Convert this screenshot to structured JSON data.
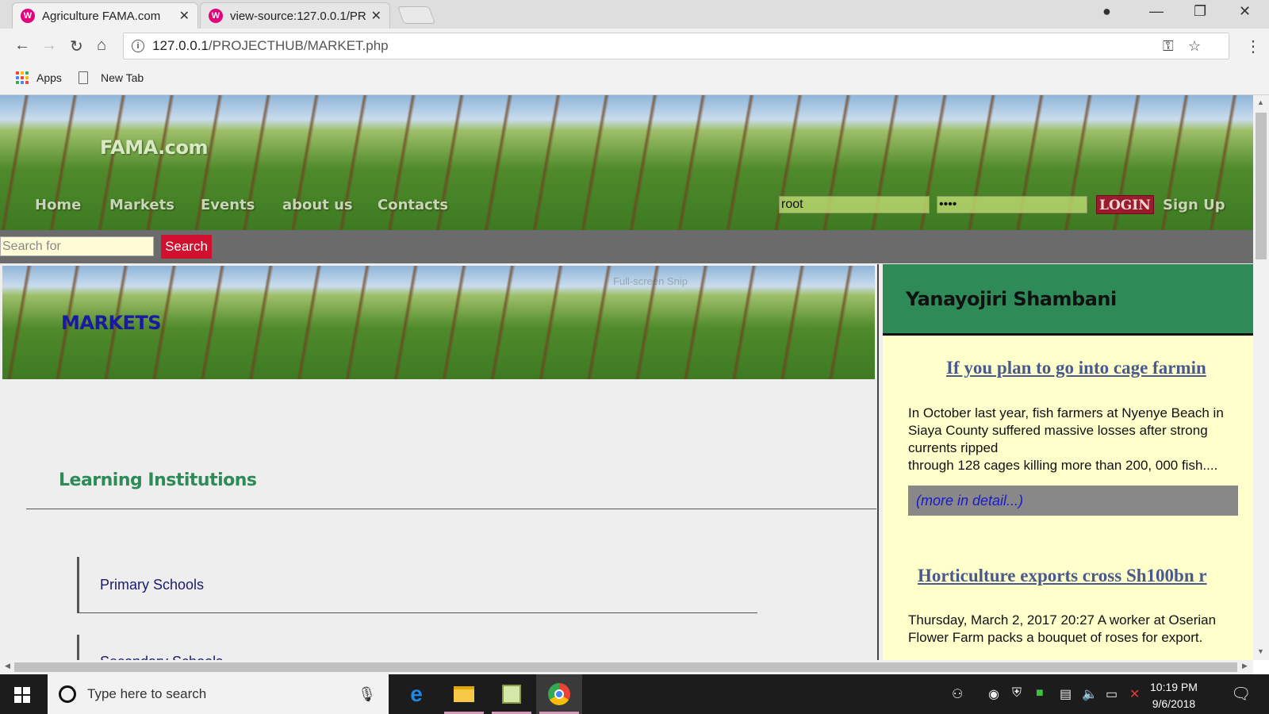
{
  "browser": {
    "tabs": [
      {
        "title": "Agriculture FAMA.com",
        "favicon": "W"
      },
      {
        "title": "view-source:127.0.0.1/PR",
        "favicon": "W"
      }
    ],
    "url_host": "127.0.0.1",
    "url_path": "/PROJECTHUB/MARKET.php",
    "bookmarks": [
      {
        "label": "Apps",
        "icon": "apps-grid-icon"
      },
      {
        "label": "New Tab",
        "icon": "page-icon"
      }
    ]
  },
  "site": {
    "logo": "FAMA.com",
    "nav": [
      "Home",
      "Markets",
      "Events",
      "about us",
      "Contacts"
    ],
    "login": {
      "username": "root",
      "password": "••••",
      "button": "LOGIN"
    },
    "signup": "Sign Up",
    "search": {
      "placeholder": "Search for",
      "button": "Search"
    },
    "banner_title": "MARKETS",
    "banner_ghost": "Full-screen Snip",
    "section_title": "Learning Institutions",
    "institutions": [
      "Primary Schools",
      "Secondary Schools"
    ],
    "sidebar": {
      "heading": "Yanayojiri Shambani",
      "news": [
        {
          "title": "If you plan to go into cage farmin",
          "body": "In October last year, fish farmers at Nyenye Beach in Siaya County suffered massive losses after strong currents ripped\nthrough 128 cages killing more than 200, 000 fish....",
          "more": "(more in detail...)"
        },
        {
          "title": "Horticulture exports cross Sh100bn r",
          "body": "Thursday, March 2, 2017 20:27 A worker at Oserian Flower Farm packs a bouquet of roses for export."
        }
      ]
    }
  },
  "taskbar": {
    "search_placeholder": "Type here to search",
    "time": "10:19 PM",
    "date": "9/6/2018"
  },
  "colors": {
    "section_green": "#2e8b57",
    "sidebar_bg": "#ffffcc",
    "search_red": "#d10f2e",
    "login_red": "#9a1c2c"
  }
}
